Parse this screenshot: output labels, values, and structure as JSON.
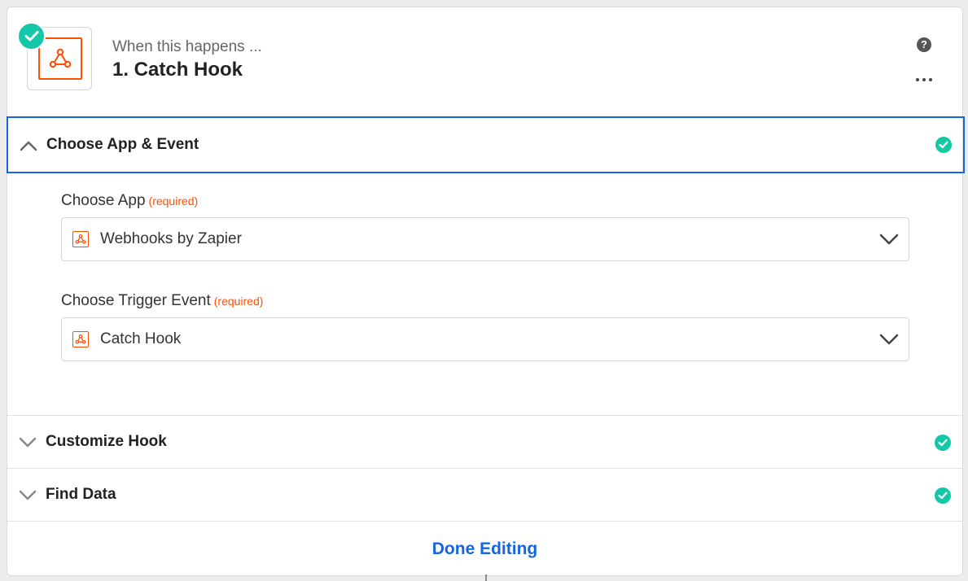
{
  "header": {
    "subtitle": "When this happens ...",
    "title": "1. Catch Hook",
    "help_icon": "question-circle-icon",
    "more_icon": "more-horizontal-icon",
    "app_icon": "webhook-icon",
    "status_icon": "check-circle-icon"
  },
  "sections": {
    "choose_app_event": {
      "label": "Choose App & Event",
      "expanded": true,
      "complete": true
    },
    "customize_hook": {
      "label": "Customize Hook",
      "expanded": false,
      "complete": true
    },
    "find_data": {
      "label": "Find Data",
      "expanded": false,
      "complete": true
    }
  },
  "form": {
    "app_field": {
      "label": "Choose App",
      "required_text": "(required)",
      "value": "Webhooks by Zapier",
      "icon": "webhook-icon"
    },
    "event_field": {
      "label": "Choose Trigger Event",
      "required_text": "(required)",
      "value": "Catch Hook",
      "icon": "webhook-icon"
    }
  },
  "footer": {
    "done_label": "Done Editing"
  },
  "colors": {
    "accent_blue": "#1565e0",
    "success_green": "#13c8a6",
    "zapier_orange": "#ff4f00"
  }
}
